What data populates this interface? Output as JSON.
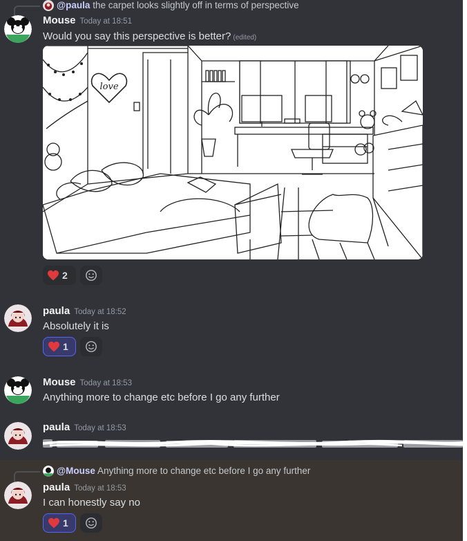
{
  "messages": [
    {
      "id": "m1",
      "reply": {
        "mention": "@paula",
        "text": "the carpet looks slightly off in terms of perspective"
      },
      "author": "Mouse",
      "timestamp": "Today at 18:51",
      "text": "Would you say this perspective is better?",
      "edited": "(edited)",
      "reactions": [
        {
          "emoji": "heart",
          "count": "2"
        }
      ]
    },
    {
      "id": "m2",
      "author": "paula",
      "timestamp": "Today at 18:52",
      "text": "Absolutely it is",
      "reactions": [
        {
          "emoji": "heart",
          "count": "1"
        }
      ]
    },
    {
      "id": "m3",
      "author": "Mouse",
      "timestamp": "Today at 18:53",
      "text": "Anything more to change etc before I go any further"
    },
    {
      "id": "m4",
      "author": "paula",
      "timestamp": "Today at 18:53",
      "text_scribbled": true
    },
    {
      "id": "m5",
      "reply": {
        "mention": "@Mouse",
        "text": "Anything more to change etc before I go any further"
      },
      "author": "paula",
      "timestamp": "Today at 18:53",
      "text": "I can honestly say no",
      "reactions": [
        {
          "emoji": "heart",
          "count": "1"
        }
      ]
    }
  ],
  "image_text": {
    "sign": "love"
  },
  "colors": {
    "background": "#313338",
    "highlight": "#3a3530",
    "accent": "#5865f2",
    "heart": "#e03a3e"
  }
}
